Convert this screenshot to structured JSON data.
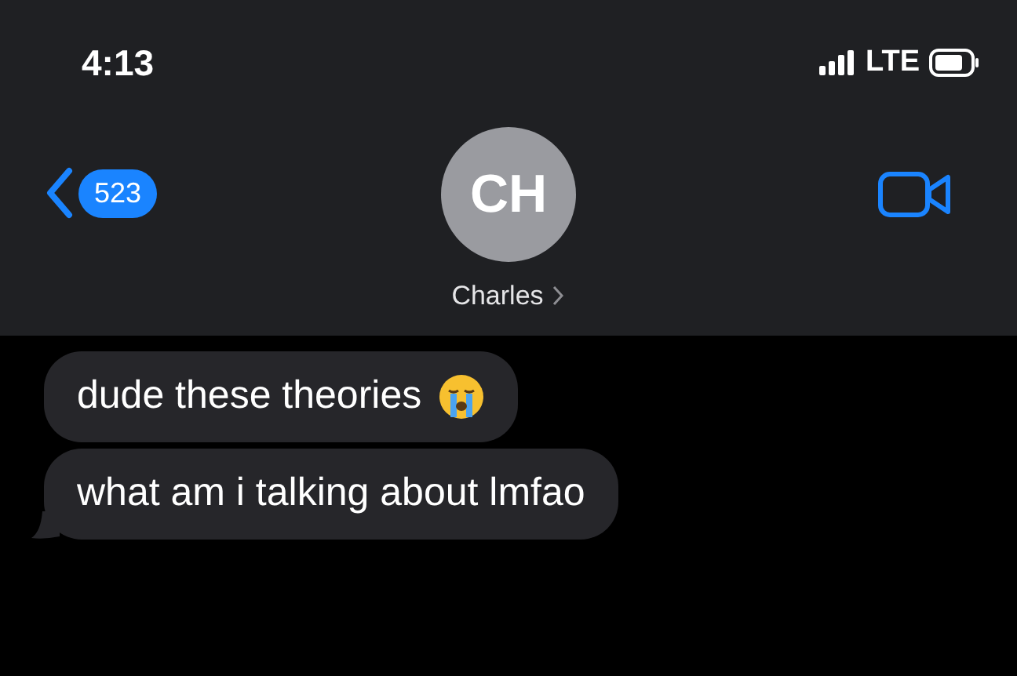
{
  "status_bar": {
    "time": "4:13",
    "network": "LTE"
  },
  "header": {
    "back_count": "523",
    "avatar_initials": "CH",
    "contact_name": "Charles"
  },
  "messages": [
    {
      "text": "dude these theories",
      "crying_emoji": true,
      "tail": false
    },
    {
      "text": "what am i talking about lmfao",
      "crying_emoji": false,
      "tail": true
    }
  ]
}
